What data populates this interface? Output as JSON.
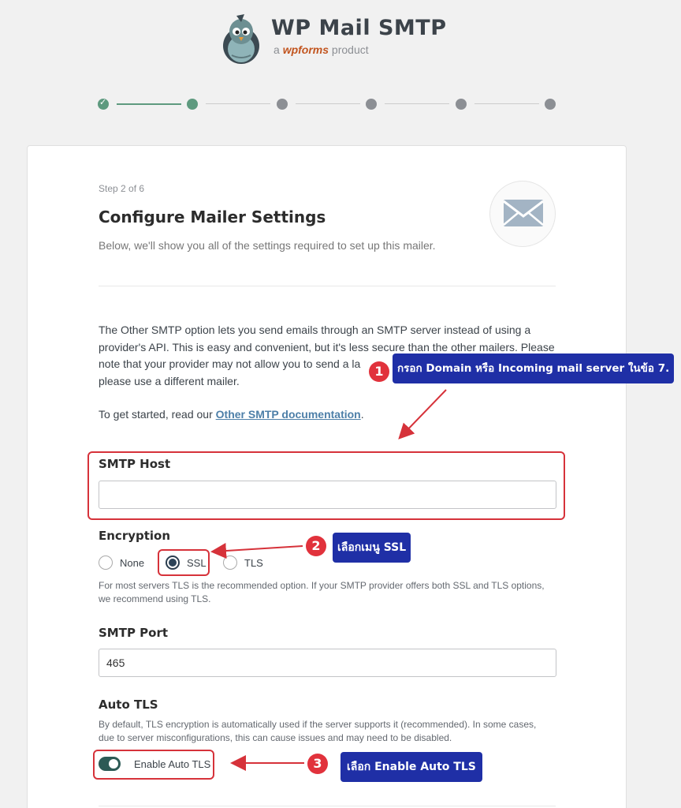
{
  "header": {
    "title": "WP Mail SMTP",
    "sub_prefix": "a",
    "sub_brand": "wpforms",
    "sub_suffix": "product"
  },
  "steps": {
    "total": 6,
    "current": 2
  },
  "card": {
    "step_label": "Step 2 of 6",
    "title": "Configure Mailer Settings",
    "description": "Below, we'll show you all of the settings required to set up this mailer.",
    "intro_lines": [
      "The Other SMTP option lets you send emails through an SMTP server instead of using a",
      "provider's API. This is easy and convenient, but it's less secure than the other mailers. Please",
      "note that your provider may not allow you to send a la",
      "please use a different mailer."
    ],
    "started_prefix": "To get started, read our ",
    "started_link": "Other SMTP documentation",
    "started_suffix": "."
  },
  "smtp_host": {
    "label": "SMTP Host",
    "value": ""
  },
  "encryption": {
    "label": "Encryption",
    "options": [
      "None",
      "SSL",
      "TLS"
    ],
    "selected": "SSL",
    "help_lines": [
      "For most servers TLS is the recommended option. If your SMTP provider offers both SSL and TLS options,",
      "we recommend using TLS."
    ]
  },
  "smtp_port": {
    "label": "SMTP Port",
    "value": "465"
  },
  "auto_tls": {
    "label": "Auto TLS",
    "help_lines": [
      "By default, TLS encryption is automatically used if the server supports it (recommended). In some cases,",
      "due to server misconfigurations, this can cause issues and may need to be disabled."
    ],
    "toggle_label": "Enable Auto TLS",
    "enabled": true
  },
  "annotations": [
    {
      "num": "1",
      "text": "กรอก Domain หรือ Incoming mail server ในข้อ 7."
    },
    {
      "num": "2",
      "text": "เลือกเมนู SSL"
    },
    {
      "num": "3",
      "text": "เลือก Enable Auto TLS"
    }
  ],
  "colors": {
    "accent_green": "#5e9a7f",
    "annotation_red": "#d6323a",
    "annotation_blue": "#1f2fa6",
    "link": "#4d7fa8"
  }
}
